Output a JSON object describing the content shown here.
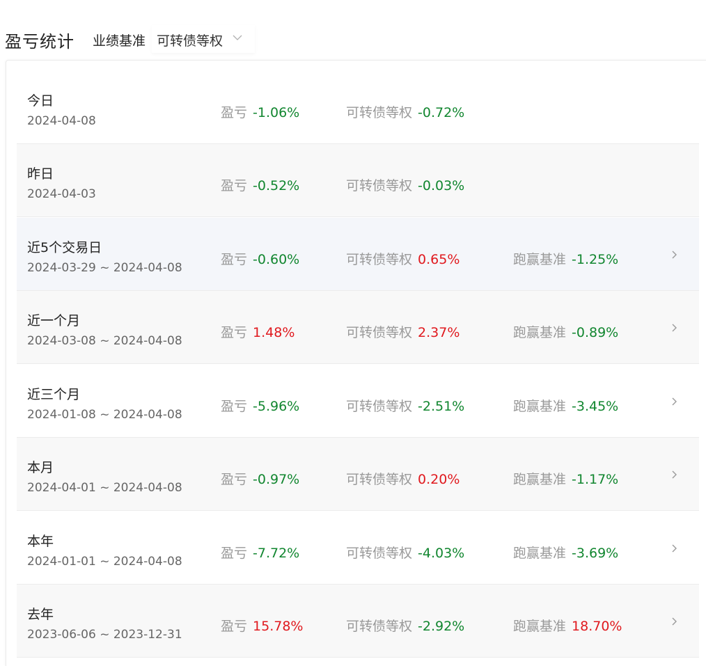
{
  "header": {
    "title": "盈亏统计",
    "benchmark_label": "业绩基准",
    "benchmark_value": "可转债等权"
  },
  "colors": {
    "gain": "#e0191e",
    "loss": "#11862f",
    "label": "#999999"
  },
  "rows": [
    {
      "title": "今日",
      "date": "2024-04-08",
      "pnl_label": "盈亏",
      "pnl": "-1.06%",
      "bench_label": "可转债等权",
      "bench": "-0.72%"
    },
    {
      "title": "昨日",
      "date": "2024-04-03",
      "pnl_label": "盈亏",
      "pnl": "-0.52%",
      "bench_label": "可转债等权",
      "bench": "-0.03%"
    },
    {
      "title": "近5个交易日",
      "date": "2024-03-29 ~ 2024-04-08",
      "pnl_label": "盈亏",
      "pnl": "-0.60%",
      "bench_label": "可转债等权",
      "bench": "0.65%",
      "excess_label": "跑赢基准",
      "excess": "-1.25%"
    },
    {
      "title": "近一个月",
      "date": "2024-03-08 ~ 2024-04-08",
      "pnl_label": "盈亏",
      "pnl": "1.48%",
      "bench_label": "可转债等权",
      "bench": "2.37%",
      "excess_label": "跑赢基准",
      "excess": "-0.89%"
    },
    {
      "title": "近三个月",
      "date": "2024-01-08 ~ 2024-04-08",
      "pnl_label": "盈亏",
      "pnl": "-5.96%",
      "bench_label": "可转债等权",
      "bench": "-2.51%",
      "excess_label": "跑赢基准",
      "excess": "-3.45%"
    },
    {
      "title": "本月",
      "date": "2024-04-01 ~ 2024-04-08",
      "pnl_label": "盈亏",
      "pnl": "-0.97%",
      "bench_label": "可转债等权",
      "bench": "0.20%",
      "excess_label": "跑赢基准",
      "excess": "-1.17%"
    },
    {
      "title": "本年",
      "date": "2024-01-01 ~ 2024-04-08",
      "pnl_label": "盈亏",
      "pnl": "-7.72%",
      "bench_label": "可转债等权",
      "bench": "-4.03%",
      "excess_label": "跑赢基准",
      "excess": "-3.69%"
    },
    {
      "title": "去年",
      "date": "2023-06-06 ~ 2023-12-31",
      "pnl_label": "盈亏",
      "pnl": "15.78%",
      "bench_label": "可转债等权",
      "bench": "-2.92%",
      "excess_label": "跑赢基准",
      "excess": "18.70%"
    }
  ]
}
